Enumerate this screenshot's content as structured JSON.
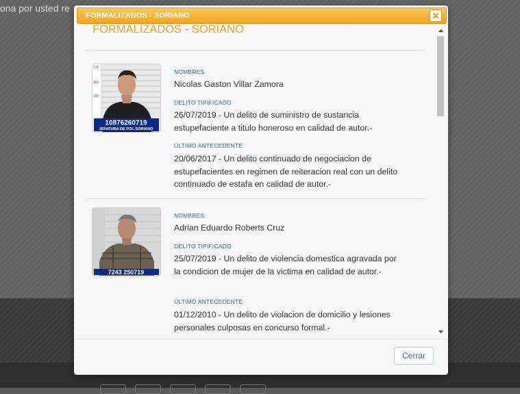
{
  "background": {
    "partial_text": "ona por usted re"
  },
  "modal": {
    "title": "FORMALIZADOS - SORIANO",
    "heading": "FORMALIZADOS - SORIANO",
    "close_label": "×",
    "close_button_text": "Cerrar",
    "records": [
      {
        "nombres_label": "NOMBRES",
        "nombres": "Nicolas Gaston Villar Zamora",
        "delito_label": "DELITO TIPIFICADO",
        "delito": "26/07/2019 - Un delito de suministro de sustancia estupefaciente a titulo honeroso en calidad de autor.-",
        "antecedente_label": "ÚLTIMO ANTECEDENTE",
        "antecedente": "20/06/2017 - Un delito continuado de negociacion de estupefacientes en regimen de reiteracion real con un delito continuado de estafa en calidad de autor.-",
        "photo_number": "10876260719",
        "photo_caption": "JEFATURA DE POL.SORIANO",
        "height_marks": [
          "170",
          "160",
          "150"
        ]
      },
      {
        "nombres_label": "NOMBRES",
        "nombres": "Adrian Eduardo Roberts Cruz",
        "delito_label": "DELITO TIPIFICADO",
        "delito": "25/07/2019 - Un delito de violencia domestica agravada por la condicion de mujer de la victima en calidad de autor.-",
        "antecedente_label": "ÚLTIMO ANTECEDENTE",
        "antecedente": "01/12/2010 - Un delito de violacion de domicilio y lesiones personales culposas en concurso formal.-",
        "photo_number": "7243 250719",
        "photo_caption": ""
      }
    ]
  },
  "colors": {
    "accent": "#f0a422",
    "label_blue": "#2b6cb0"
  }
}
